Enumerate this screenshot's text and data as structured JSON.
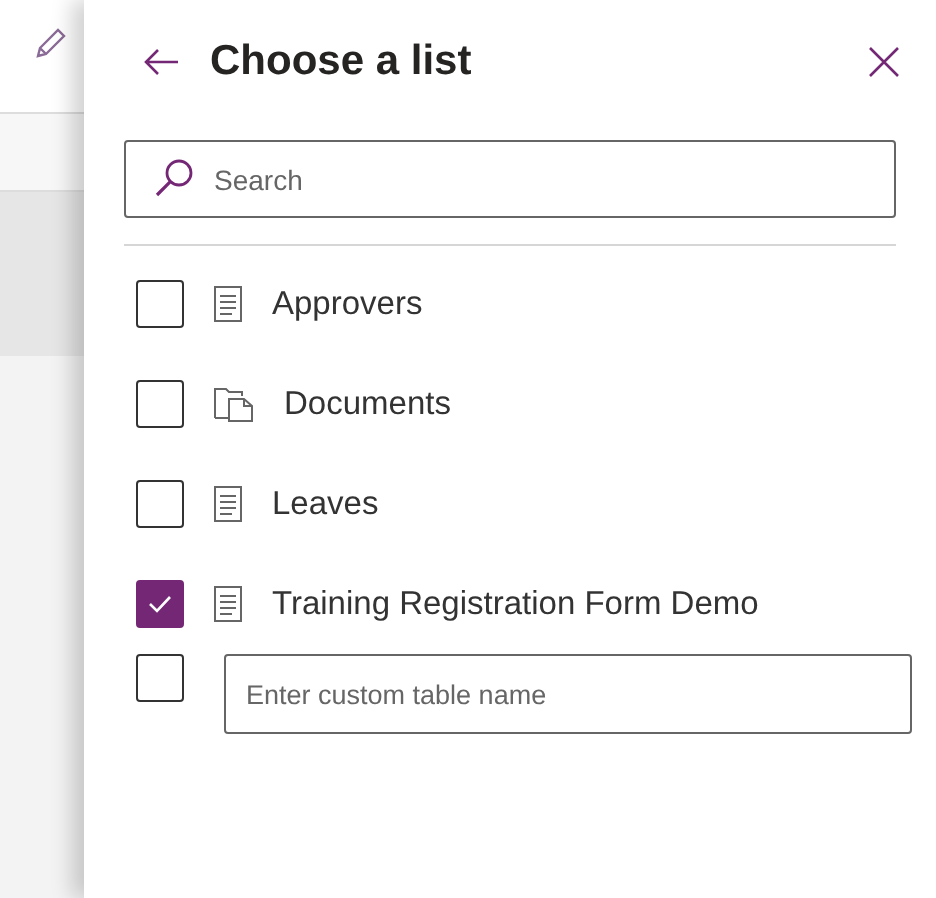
{
  "panel": {
    "title": "Choose a list"
  },
  "search": {
    "placeholder": "Search"
  },
  "lists": [
    {
      "label": "Approvers",
      "kind": "list",
      "checked": false
    },
    {
      "label": "Documents",
      "kind": "library",
      "checked": false
    },
    {
      "label": "Leaves",
      "kind": "list",
      "checked": false
    },
    {
      "label": "Training Registration Form Demo",
      "kind": "list",
      "checked": true
    }
  ],
  "custom": {
    "checked": false,
    "placeholder": "Enter custom table name"
  }
}
